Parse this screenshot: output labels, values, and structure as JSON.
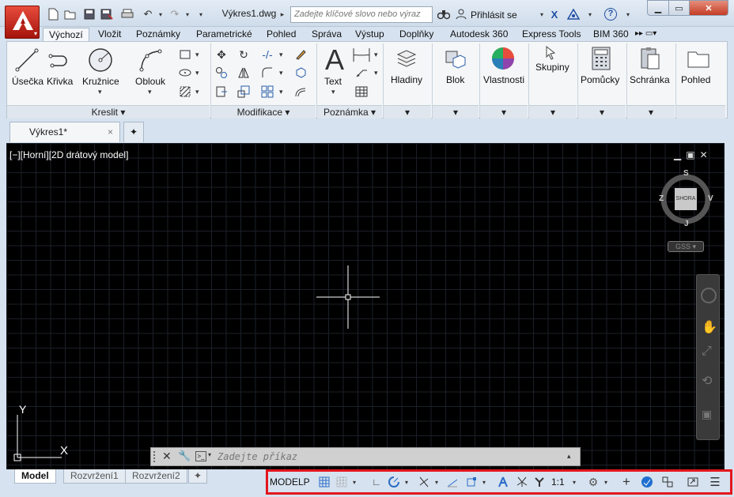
{
  "title_bar": {
    "doc_title": "Výkres1.dwg",
    "search_placeholder": "Zadejte klíčové slovo nebo výraz",
    "signin": "Přihlásit se",
    "help": "?"
  },
  "menu_tabs": [
    "Výchozí",
    "Vložit",
    "Poznámky",
    "Parametrické",
    "Pohled",
    "Správa",
    "Výstup",
    "Doplňky",
    "Autodesk 360",
    "Express Tools",
    "BIM 360"
  ],
  "ribbon": {
    "draw": {
      "title": "Kreslit",
      "line": "Úsečka",
      "polyline": "Křivka",
      "circle": "Kružnice",
      "arc": "Oblouk"
    },
    "modify": {
      "title": "Modifikace"
    },
    "annotation": {
      "title": "Poznámka",
      "text": "Text"
    },
    "layers": "Hladiny",
    "block": "Blok",
    "properties": "Vlastnosti",
    "groups": "Skupiny",
    "utilities": "Pomůcky",
    "clipboard": "Schránka",
    "view": "Pohled"
  },
  "file_tabs": {
    "active": "Výkres1*"
  },
  "viewport": {
    "label": "[−][Horní][2D drátový model]",
    "viewcube": {
      "top": "S",
      "left": "Z",
      "right": "V",
      "bottom": "J",
      "face": "SHORA",
      "ucs": "GSS"
    },
    "axis_x": "X",
    "axis_y": "Y"
  },
  "command_line": {
    "placeholder": "Zadejte příkaz"
  },
  "layout_tabs": [
    "Model",
    "Rozvržení1",
    "Rozvržení2"
  ],
  "status_bar": {
    "model": "MODELP",
    "scale": "1:1"
  },
  "colors": {
    "accent": "#2a6cc7",
    "highlight": "#e4161e",
    "app_red": "#c8231b"
  }
}
